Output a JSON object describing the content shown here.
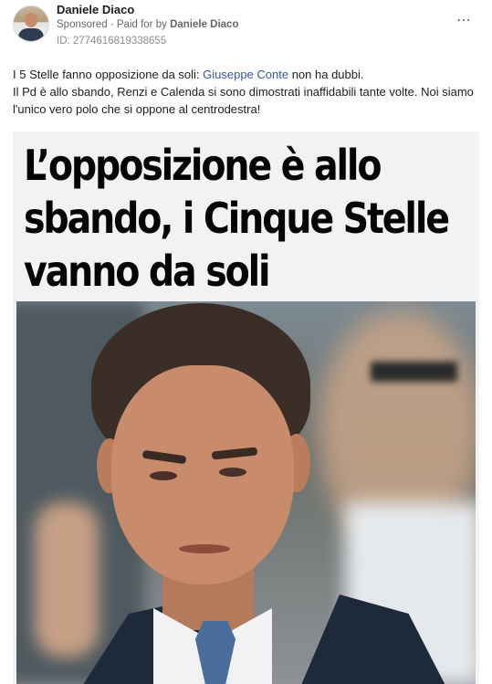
{
  "post": {
    "author": "Daniele Diaco",
    "sponsored_label": "Sponsored",
    "separator": "·",
    "paid_prefix": "Paid for by",
    "paid_by": "Daniele Diaco",
    "ad_id": "ID: 2774616819338655",
    "more_icon": "⋯"
  },
  "body": {
    "line1_pre": "I 5 Stelle fanno opposizione da soli: ",
    "line1_link": "Giuseppe Conte",
    "line1_post": " non ha dubbi.",
    "line2": "Il Pd è allo sbando, Renzi e Calenda si sono dimostrati inaffidabili tante volte. Noi siamo l'unico vero polo che si oppone al centrodestra!"
  },
  "image": {
    "headline_lines": [
      "L’opposizione è allo",
      "sbando, i Cinque Stelle",
      "vanno da soli"
    ]
  },
  "colors": {
    "link": "#385898",
    "meta": "#65676b"
  }
}
